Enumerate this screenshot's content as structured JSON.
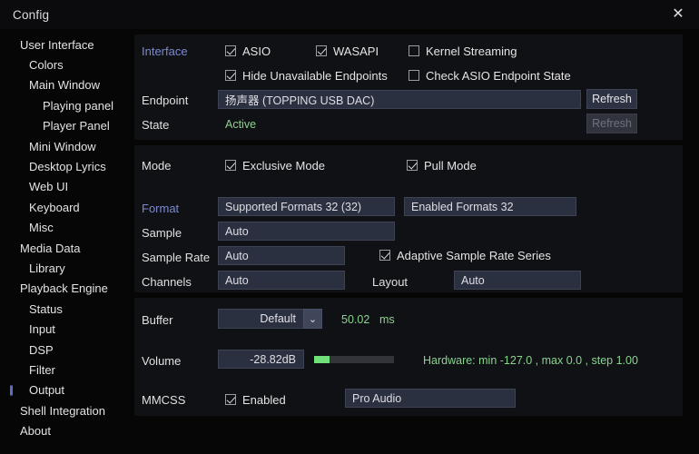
{
  "window": {
    "title": "Config",
    "close_icon": "close-icon",
    "close_glyph": "✕"
  },
  "sidebar": {
    "items": [
      {
        "label": "User Interface",
        "level": 0,
        "selected": false
      },
      {
        "label": "Colors",
        "level": 1,
        "selected": false
      },
      {
        "label": "Main Window",
        "level": 1,
        "selected": false
      },
      {
        "label": "Playing panel",
        "level": 2,
        "selected": false
      },
      {
        "label": "Player Panel",
        "level": 2,
        "selected": false
      },
      {
        "label": "Mini Window",
        "level": 1,
        "selected": false
      },
      {
        "label": "Desktop Lyrics",
        "level": 1,
        "selected": false
      },
      {
        "label": "Web UI",
        "level": 1,
        "selected": false
      },
      {
        "label": "Keyboard",
        "level": 1,
        "selected": false
      },
      {
        "label": "Misc",
        "level": 1,
        "selected": false
      },
      {
        "label": "Media Data",
        "level": 0,
        "selected": false
      },
      {
        "label": "Library",
        "level": 1,
        "selected": false
      },
      {
        "label": "Playback Engine",
        "level": 0,
        "selected": false
      },
      {
        "label": "Status",
        "level": 1,
        "selected": false
      },
      {
        "label": "Input",
        "level": 1,
        "selected": false
      },
      {
        "label": "DSP",
        "level": 1,
        "selected": false
      },
      {
        "label": "Filter",
        "level": 1,
        "selected": false
      },
      {
        "label": "Output",
        "level": 1,
        "selected": true
      },
      {
        "label": "Shell Integration",
        "level": 0,
        "selected": false
      },
      {
        "label": "About",
        "level": 0,
        "selected": false
      }
    ]
  },
  "interface_panel": {
    "label": "Interface",
    "asio": {
      "label": "ASIO",
      "checked": true
    },
    "wasapi": {
      "label": "WASAPI",
      "checked": true
    },
    "kernel_streaming": {
      "label": "Kernel Streaming",
      "checked": false
    },
    "hide_unavailable": {
      "label": "Hide Unavailable Endpoints",
      "checked": true
    },
    "check_asio_state": {
      "label": "Check ASIO Endpoint State",
      "checked": false
    },
    "endpoint_label": "Endpoint",
    "endpoint_value": "扬声器 (TOPPING USB DAC)",
    "refresh_endpoint_label": "Refresh",
    "state_label": "State",
    "state_value": "Active",
    "state_color": "#8ad28f",
    "refresh_state_label": "Refresh"
  },
  "format_panel": {
    "mode_label": "Mode",
    "exclusive_mode": {
      "label": "Exclusive Mode",
      "checked": true
    },
    "pull_mode": {
      "label": "Pull Mode",
      "checked": true
    },
    "format_label": "Format",
    "supported_formats": "Supported Formats 32 (32)",
    "enabled_formats": "Enabled Formats 32",
    "sample_label": "Sample",
    "sample_value": "Auto",
    "sample_rate_label": "Sample Rate",
    "sample_rate_value": "Auto",
    "adaptive_sample_rate": {
      "label": "Adaptive Sample Rate Series",
      "checked": true
    },
    "channels_label": "Channels",
    "channels_value": "Auto",
    "layout_label": "Layout",
    "layout_value": "Auto"
  },
  "extra_panel": {
    "buffer_label": "Buffer",
    "buffer_value": "Default",
    "buffer_arrow": "⌄",
    "buffer_time": "50.02",
    "buffer_unit": "ms",
    "volume_label": "Volume",
    "volume_value": "-28.82dB",
    "volume_fill_percent": 19,
    "volume_hardware_info": "Hardware: min -127.0 , max  0.0 , step  1.00",
    "mmcss_label": "MMCSS",
    "mmcss_enabled": {
      "label": "Enabled",
      "checked": true
    },
    "mmcss_profile": "Pro Audio"
  },
  "colors": {
    "accent_label": "#7b8ad2",
    "green": "#8ad28f",
    "slider_fill": "#6fe07a",
    "selection_marker": "#5b6ec4",
    "panel_bg": "#101114",
    "window_bg": "#060607"
  }
}
